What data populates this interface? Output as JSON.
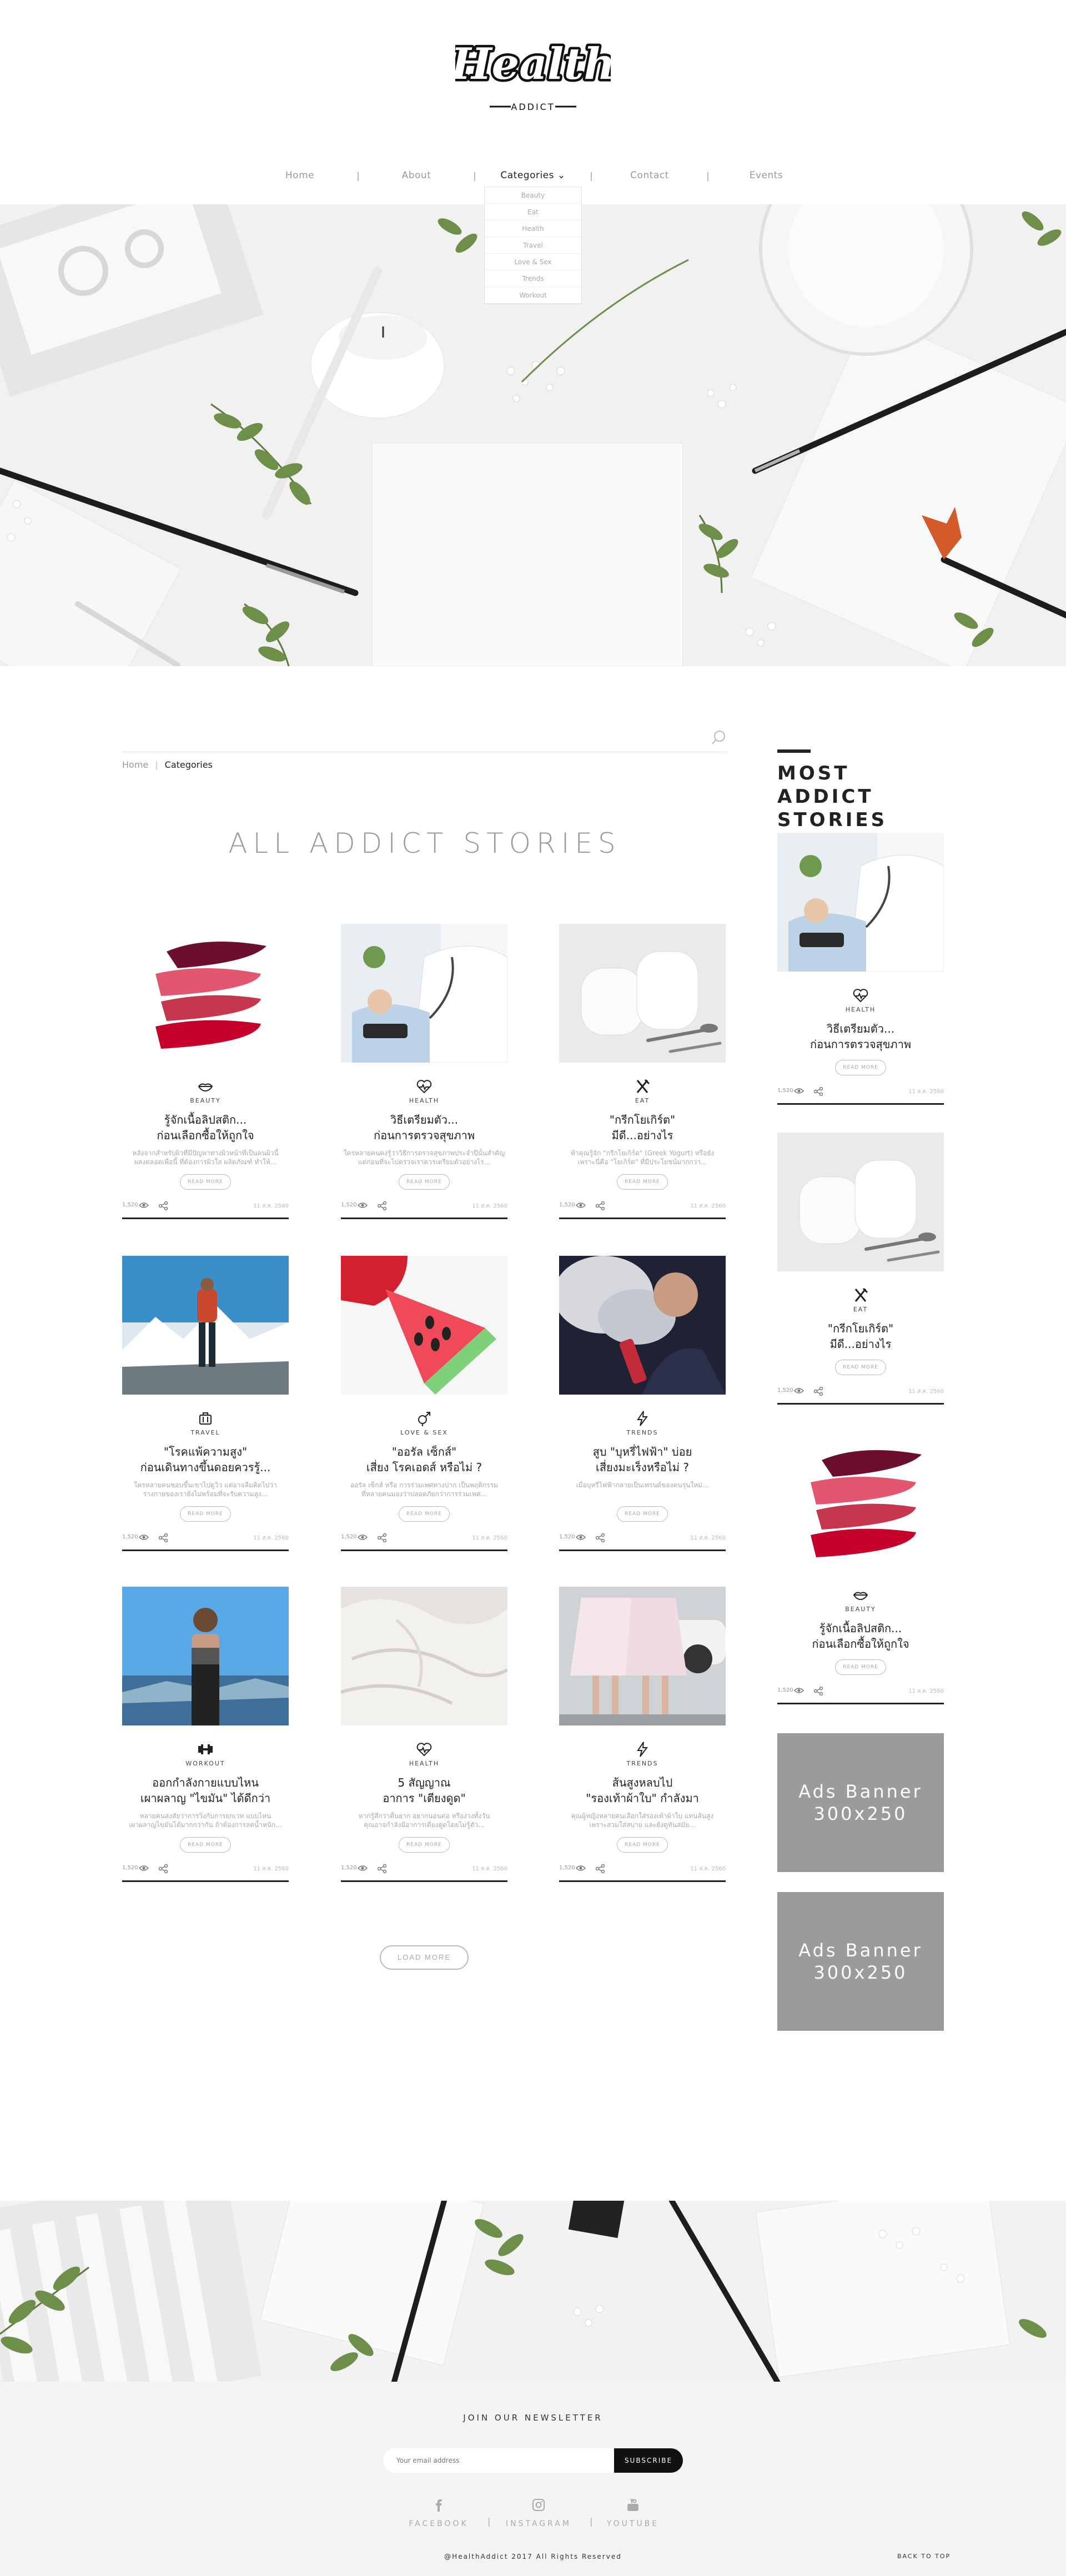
{
  "header": {
    "logo_script": "Health",
    "logo_sub": "ADDICT"
  },
  "nav": {
    "items": [
      {
        "label": "Home"
      },
      {
        "label": "About"
      },
      {
        "label": "Categories ⌄"
      },
      {
        "label": "Contact"
      },
      {
        "label": "Events"
      }
    ],
    "dropdown": [
      "Beauty",
      "Eat",
      "Health",
      "Travel",
      "Love & Sex",
      "Trends",
      "Workout"
    ]
  },
  "breadcrumb": {
    "home": "Home",
    "current": "Categories"
  },
  "main": {
    "title": "ALL ADDICT STORIES",
    "read_more": "READ MORE",
    "load_more": "LOAD MORE",
    "cards": [
      {
        "category": "BEAUTY",
        "icon": "lips-icon",
        "title": "รู้จักเนื้อลิปสติก...\nก่อนเลือกซื้อให้ถูกใจ",
        "excerpt": "หลังจากสำหรับผิวที่มีปัญหาทางผิวหน้าที่เป็นคนผิวนี้\nผลงตลอดเพื่อนี้ ที่ต้องการผิวใส ผลิตภัณฑ์ ทำให้...",
        "views": "1,520",
        "date": "11 ส.ค. 2560"
      },
      {
        "category": "HEALTH",
        "icon": "heart-pulse-icon",
        "title": "วิธีเตรียมตัว...\nก่อนการตรวจสุขภาพ",
        "excerpt": "ใครหลายคนคงรู้ว่าวิธีการตรวจสุขภาพประจำปีนั้นสำคัญ\nแต่ก่อนที่จะไปตรวจเราควรเตรียมตัวอย่างไร...",
        "views": "1,520",
        "date": "11 ส.ค. 2560"
      },
      {
        "category": "EAT",
        "icon": "fork-knife-icon",
        "title": "\"กรีกโยเกิร์ต\"\nมีดี...อย่างไร",
        "excerpt": "ท้าคุณรู้จัก \"กรีกโยเกิร์ต\" (Greek Yogurt) หรือยัง\nเพราะนี่คือ \"โยเกิร์ต\" ที่มีประโยชน์มากกว่า...",
        "views": "1,520",
        "date": "11 ส.ค. 2560"
      },
      {
        "category": "TRAVEL",
        "icon": "luggage-icon",
        "title": "\"โรคแพ้ความสูง\"\nก่อนเดินทางขึ้นดอยควรรู้...",
        "excerpt": "ใครหลายคนชอบขึ้นเขาไปดูวิว แต่อาจลืมคิดไปว่า\nร่างกายของเรายังไม่พร้อมที่จะรับความสูง...",
        "views": "1,520",
        "date": "11 ส.ค. 2560"
      },
      {
        "category": "LOVE & SEX",
        "icon": "gender-icon",
        "title": "\"ออรัล เซ็กส์\"\nเสี่ยง โรคเอดส์ หรือไม่ ?",
        "excerpt": "ออรัล เซ็กส์ หรือ การร่วมเพศทางปาก เป็นพฤติกรรม\nที่หลายคนมองว่าปลอดภัยกว่าการร่วมเพศ...",
        "views": "1,520",
        "date": "11 ส.ค. 2560"
      },
      {
        "category": "TRENDS",
        "icon": "bolt-icon",
        "title": "สูบ \"บุหรี่ไฟฟ้า\" บ่อย\nเสี่ยงมะเร็งหรือไม่ ?",
        "excerpt": "เมื่อบุหรี่ไฟฟ้ากลายเป็นเทรนด์ของคนรุ่นใหม่...",
        "views": "1,520",
        "date": "11 ส.ค. 2560"
      },
      {
        "category": "WORKOUT",
        "icon": "dumbbell-icon",
        "title": "ออกกำลังกายแบบไหน\nเผาผลาญ \"ไขมัน\" ได้ดีกว่า",
        "excerpt": "หลายคนสงสัยว่าการวิ่งกับการยกเวท แบบไหน\nเผาผลาญไขมันได้มากกว่ากัน ถ้าต้องการลดน้ำหนัก...",
        "views": "1,520",
        "date": "11 ส.ค. 2560"
      },
      {
        "category": "HEALTH",
        "icon": "heart-pulse-icon",
        "title": "5 สัญญาณ\nอาการ \"เตียงดูด\"",
        "excerpt": "หากรู้สึกว่าตื่นยาก อยากนอนต่อ หรือง่วงทั้งวัน\nคุณอาจกำลังมีอาการเตียงดูดโดยไม่รู้ตัว...",
        "views": "1,520",
        "date": "11 ส.ค. 2560"
      },
      {
        "category": "TRENDS",
        "icon": "bolt-icon",
        "title": "ส้นสูงหลบไป\n\"รองเท้าผ้าใบ\" กำลังมา",
        "excerpt": "คุณผู้หญิงหลายคนเลือกใส่รองเท้าผ้าใบ แทนส้นสูง\nเพราะสวมใส่สบาย และยังดูทันสมัย...",
        "views": "1,520",
        "date": "11 ส.ค. 2560"
      }
    ]
  },
  "sidebar": {
    "title": "MOST ADDICT\nSTORIES",
    "ad_text": "Ads Banner\n300x250",
    "items": [
      {
        "category": "HEALTH",
        "icon": "heart-pulse-icon",
        "title": "วิธีเตรียมตัว...\nก่อนการตรวจสุขภาพ",
        "views": "1,520",
        "date": "11 ส.ค. 2560"
      },
      {
        "category": "EAT",
        "icon": "fork-knife-icon",
        "title": "\"กรีกโยเกิร์ต\"\nมีดี...อย่างไร",
        "views": "1,520",
        "date": "11 ส.ค. 2560"
      },
      {
        "category": "BEAUTY",
        "icon": "lips-icon",
        "title": "รู้จักเนื้อลิปสติก...\nก่อนเลือกซื้อให้ถูกใจ",
        "views": "1,520",
        "date": "11 ส.ค. 2560"
      }
    ]
  },
  "footer": {
    "newsletter_title": "JOIN OUR NEWSLETTER",
    "email_placeholder": "Your email address",
    "subscribe": "SUBSCRIBE",
    "social": [
      "FACEBOOK",
      "INSTAGRAM",
      "YOUTUBE"
    ],
    "copyright": "@HealthAddict 2017 All Rights Reserved",
    "back_to_top": "BACK TO TOP"
  },
  "colors": {
    "accent": "#111111",
    "muted": "#9a9a9a",
    "ad_bg": "#9b9b9b"
  }
}
